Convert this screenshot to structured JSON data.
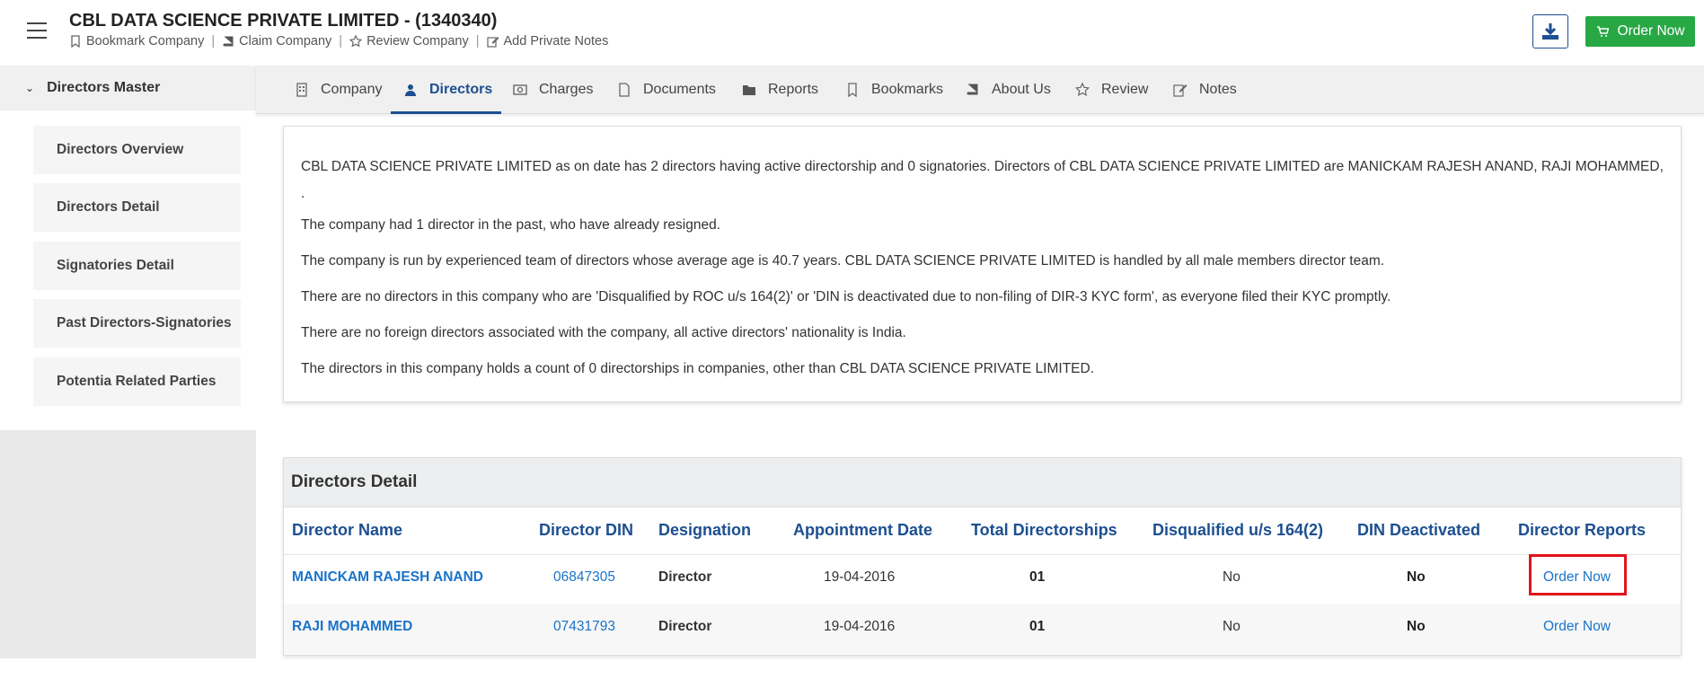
{
  "header": {
    "company_title": "CBL DATA SCIENCE PRIVATE LIMITED - (1340340)",
    "actions": [
      "Bookmark Company",
      "Claim Company",
      "Review Company",
      "Add Private Notes"
    ],
    "separator": "|",
    "order_now": "Order Now"
  },
  "sidebar": {
    "section": "Directors Master",
    "items": [
      "Directors Overview",
      "Directors Detail",
      "Signatories Detail",
      "Past Directors-Signatories",
      "Potentia Related Parties"
    ]
  },
  "tabs": [
    "Company",
    "Directors",
    "Charges",
    "Documents",
    "Reports",
    "Bookmarks",
    "About Us",
    "Review",
    "Notes"
  ],
  "active_tab": "Directors",
  "summary": {
    "paragraphs": [
      "CBL DATA SCIENCE PRIVATE LIMITED as on date has 2 directors having active directorship and 0 signatories. Directors of CBL DATA SCIENCE PRIVATE LIMITED are MANICKAM RAJESH ANAND, RAJI MOHAMMED, .",
      "The company had 1 director in the past, who have already resigned.",
      "The company is run by experienced team of directors whose average age is 40.7 years. CBL DATA SCIENCE PRIVATE LIMITED is handled by all male members director team.",
      "There are no directors in this company who are 'Disqualified by ROC u/s 164(2)' or 'DIN is deactivated due to non-filing of DIR-3 KYC form', as everyone filed their KYC promptly.",
      "There are no foreign directors associated with the company, all active directors' nationality is India.",
      "The directors in this company holds a count of 0 directorships in companies, other than CBL DATA SCIENCE PRIVATE LIMITED."
    ]
  },
  "directors_detail": {
    "title": "Directors Detail",
    "columns": [
      "Director Name",
      "Director DIN",
      "Designation",
      "Appointment Date",
      "Total Directorships",
      "Disqualified u/s 164(2)",
      "DIN Deactivated",
      "Director Reports"
    ],
    "rows": [
      {
        "name": "MANICKAM RAJESH ANAND",
        "din": "06847305",
        "designation": "Director",
        "date": "19-04-2016",
        "total": "01",
        "disqualified": "No",
        "deactivated": "No",
        "report": "Order Now"
      },
      {
        "name": "RAJI MOHAMMED",
        "din": "07431793",
        "designation": "Director",
        "date": "19-04-2016",
        "total": "01",
        "disqualified": "No",
        "deactivated": "No",
        "report": "Order Now"
      }
    ]
  },
  "colors": {
    "brand_blue": "#1d4f91",
    "link_blue": "#1a73c9",
    "order_green": "#28a745",
    "highlight_red": "#e0141a"
  },
  "icons": [
    "hamburger-icon",
    "bookmark-icon",
    "book-icon",
    "star-icon",
    "edit-icon",
    "download-icon",
    "cart-icon",
    "chevron-down-icon",
    "building-icon",
    "user-icon",
    "money-icon",
    "document-icon",
    "folder-icon"
  ]
}
